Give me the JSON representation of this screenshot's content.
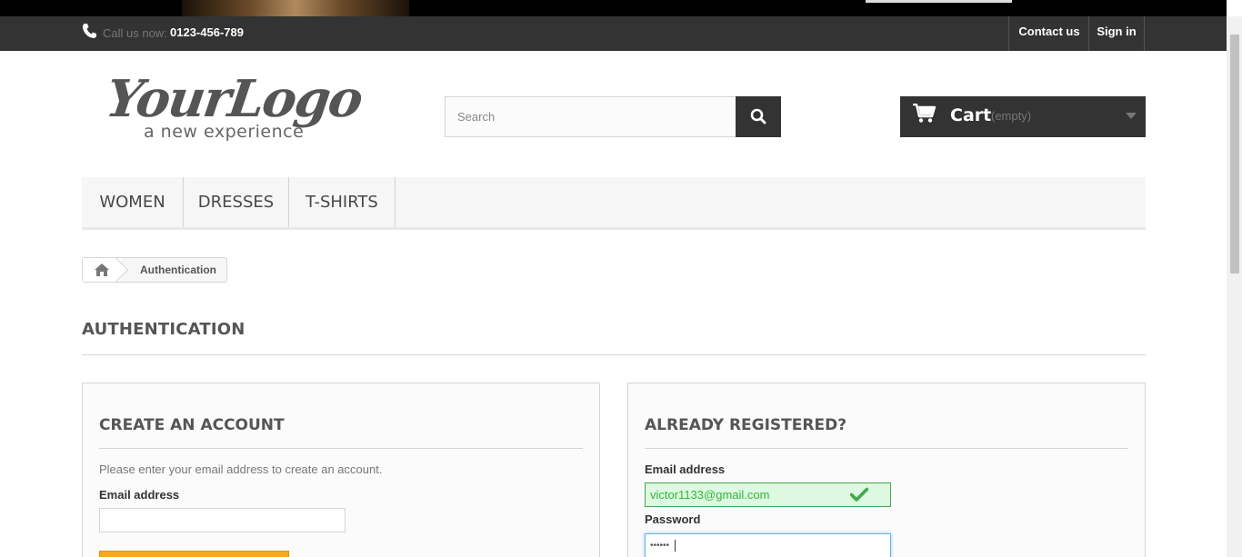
{
  "header": {
    "call_prefix": "Call us now:",
    "phone_number": "0123-456-789",
    "contact_link": "Contact us",
    "signin_link": "Sign in"
  },
  "logo": {
    "main": "YourLogo",
    "tagline": "a new experience"
  },
  "search": {
    "placeholder": "Search"
  },
  "cart": {
    "label": "Cart",
    "status": "(empty)"
  },
  "menu": {
    "items": [
      {
        "label": "WOMEN"
      },
      {
        "label": "DRESSES"
      },
      {
        "label": "T-SHIRTS"
      }
    ]
  },
  "breadcrumb": {
    "current": "Authentication"
  },
  "page": {
    "heading": "AUTHENTICATION"
  },
  "create_account": {
    "title": "CREATE AN ACCOUNT",
    "description": "Please enter your email address to create an account.",
    "email_label": "Email address",
    "email_value": ""
  },
  "login": {
    "title": "ALREADY REGISTERED?",
    "email_label": "Email address",
    "email_value": "victor1133@gmail.com",
    "password_label": "Password",
    "password_value": "••••••"
  },
  "colors": {
    "dark_bar": "#333333",
    "valid_green": "#46a74e",
    "focus_blue": "#66afe9",
    "button_orange": "#f6a91d"
  },
  "icons": [
    "phone-icon",
    "search-icon",
    "cart-icon",
    "chevron-down-icon",
    "home-icon",
    "checkmark-icon"
  ]
}
